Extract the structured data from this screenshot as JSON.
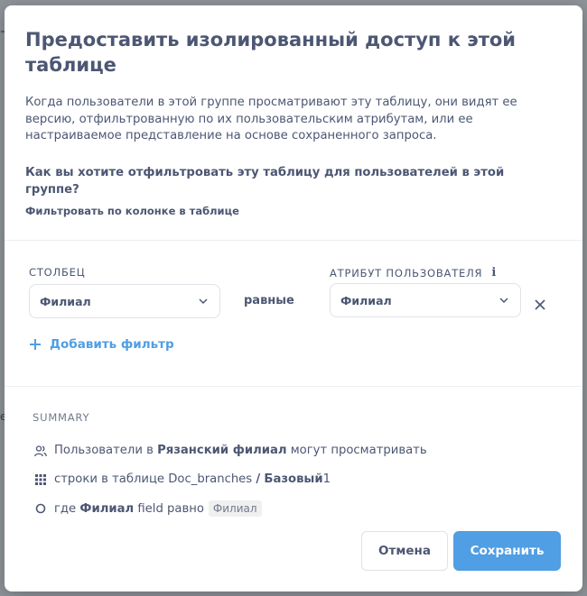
{
  "modal": {
    "title": "Предоставить изолированный доступ к этой таблице",
    "description": "Когда пользователи в этой группе просматривают эту таблицу, они видят ее версию, отфильтрованную по их пользовательским атрибутам, или ее настраиваемое представление на основе сохраненного запроса.",
    "question": "Как вы хотите отфильтровать эту таблицу для пользователей в этой группе?",
    "filter_option": "Фильтровать по колонке в таблице"
  },
  "filter": {
    "column_label": "СТОЛБЕЦ",
    "column_value": "Филиал",
    "operator": "равные",
    "attribute_label": "АТРИБУТ ПОЛЬЗОВАТЕЛЯ",
    "attribute_value": "Филиал",
    "add_filter": "Добавить фильтр"
  },
  "summary": {
    "title": "SUMMARY",
    "row1_prefix": "Пользователи в",
    "row1_group": "Рязанский филиал",
    "row1_suffix": "могут просматривать",
    "row2_prefix": "строки в таблице",
    "row2_table": "Doc_branches",
    "row2_sep": "/",
    "row2_schema": "Базовый",
    "row2_num": "1",
    "row3_prefix": "где",
    "row3_field": "Филиал",
    "row3_mid": "field равно",
    "row3_attr": "Филиал"
  },
  "buttons": {
    "cancel": "Отмена",
    "save": "Сохранить"
  },
  "colors": {
    "brand": "#509ee3",
    "text": "#4c5773"
  }
}
